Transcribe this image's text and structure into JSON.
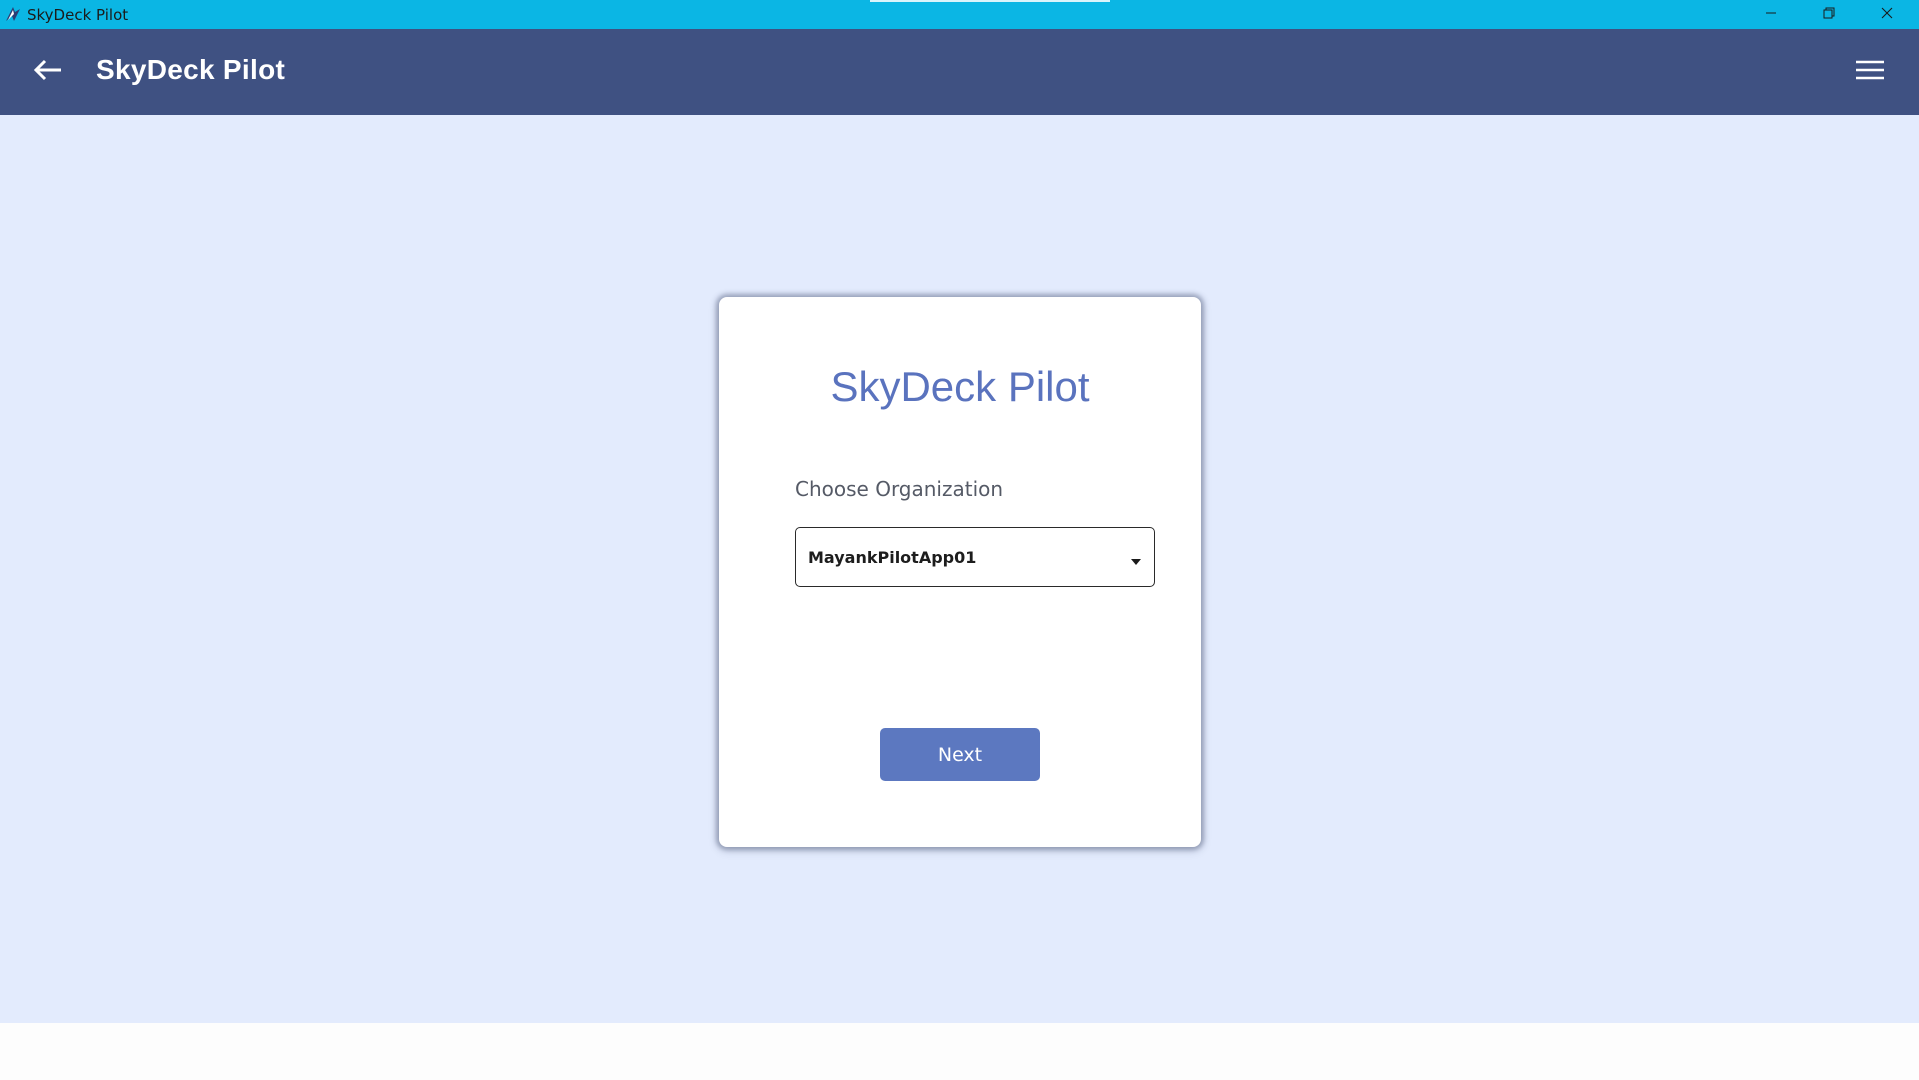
{
  "window": {
    "title": "SkyDeck Pilot",
    "controls": {
      "minimize": "minimize-icon",
      "restore": "restore-icon",
      "close": "close-icon"
    }
  },
  "appbar": {
    "title": "SkyDeck Pilot",
    "back_icon": "arrow-left-icon",
    "menu_icon": "hamburger-menu-icon"
  },
  "card": {
    "title": "SkyDeck Pilot",
    "organization_label": "Choose Organization",
    "organization_selected": "MayankPilotApp01",
    "next_label": "Next"
  },
  "colors": {
    "titlebar": "#0bb6e4",
    "appbar": "#3f5182",
    "background": "#e3ebfd",
    "accent": "#5c78c0",
    "card_title": "#5a73be"
  }
}
